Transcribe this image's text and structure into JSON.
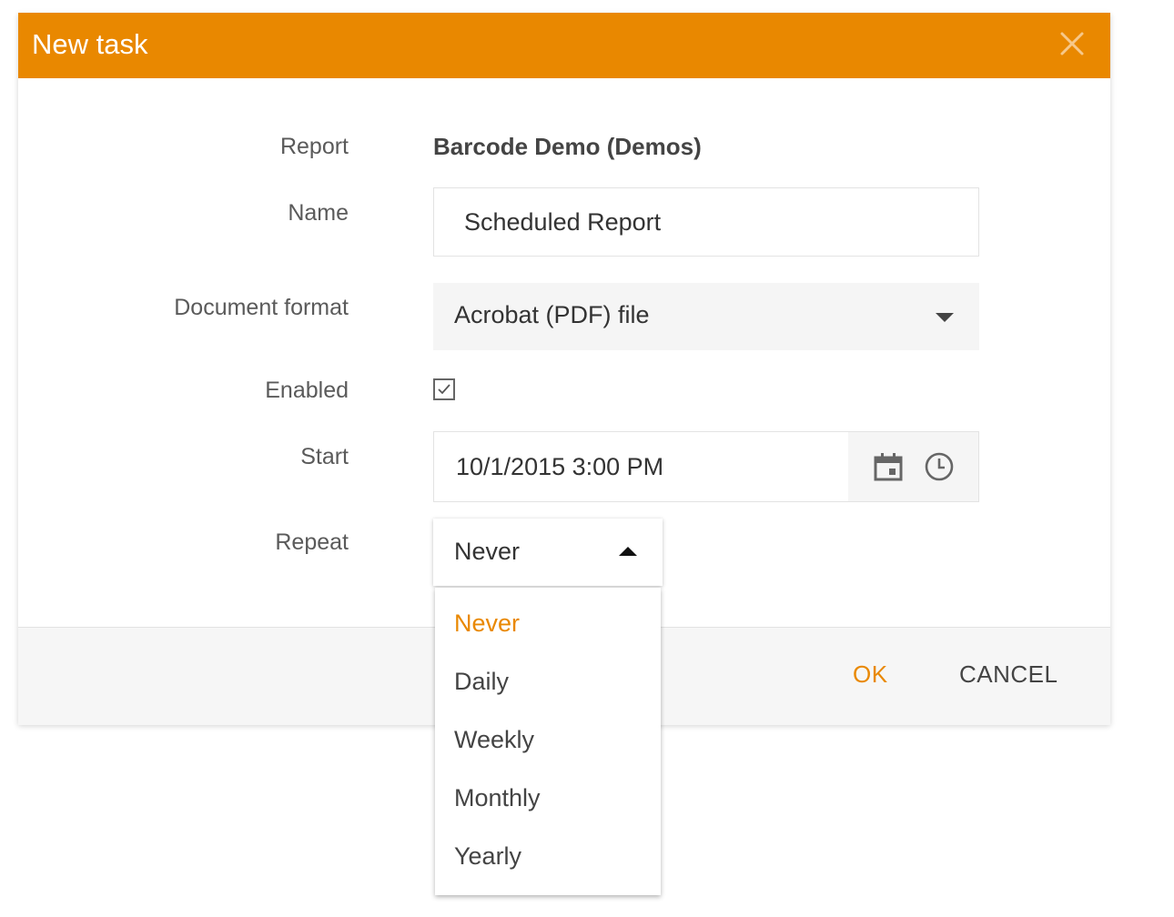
{
  "dialog": {
    "title": "New task",
    "accent_color": "#e98800",
    "close_icon": "close-icon"
  },
  "form": {
    "report_label": "Report",
    "report_value": "Barcode Demo (Demos)",
    "name_label": "Name",
    "name_value": "Scheduled Report",
    "format_label": "Document format",
    "format_value": "Acrobat (PDF) file",
    "enabled_label": "Enabled",
    "enabled_checked": true,
    "start_label": "Start",
    "start_value": "10/1/2015 3:00 PM",
    "calendar_icon": "calendar-icon",
    "clock_icon": "clock-icon",
    "repeat_label": "Repeat",
    "repeat_value": "Never"
  },
  "repeat_options": {
    "items": [
      {
        "label": "Never",
        "selected": true
      },
      {
        "label": "Daily",
        "selected": false
      },
      {
        "label": "Weekly",
        "selected": false
      },
      {
        "label": "Monthly",
        "selected": false
      },
      {
        "label": "Yearly",
        "selected": false
      }
    ]
  },
  "footer": {
    "ok_label": "OK",
    "cancel_label": "CANCEL"
  }
}
